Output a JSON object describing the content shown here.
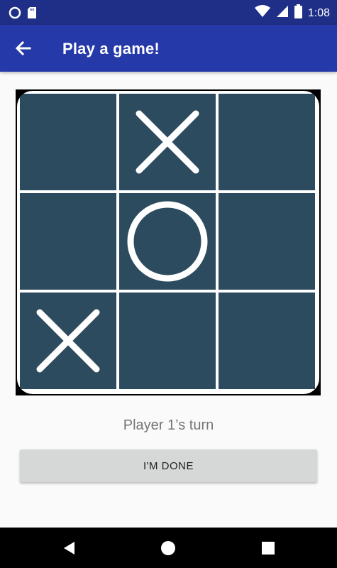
{
  "status_bar": {
    "time": "1:08",
    "icons": [
      "circle-notification-icon",
      "sd-card-icon",
      "wifi-icon",
      "cell-signal-icon",
      "battery-icon"
    ]
  },
  "app_bar": {
    "title": "Play a game!",
    "back_icon": "arrow-back-icon"
  },
  "board": {
    "cells": [
      "",
      "X",
      "",
      "",
      "O",
      "",
      "X",
      "",
      ""
    ],
    "cell_color": "#2c4b5e",
    "line_color": "#ffffff"
  },
  "turn_text": "Player 1’s turn",
  "done_button_label": "I'M DONE",
  "nav_bar": {
    "icons": [
      "back-triangle-icon",
      "home-circle-icon",
      "recents-square-icon"
    ]
  },
  "colors": {
    "status_bar": "#1f2f87",
    "app_bar": "#2639a8",
    "background": "#fafafa",
    "button": "#d6d7d7"
  }
}
